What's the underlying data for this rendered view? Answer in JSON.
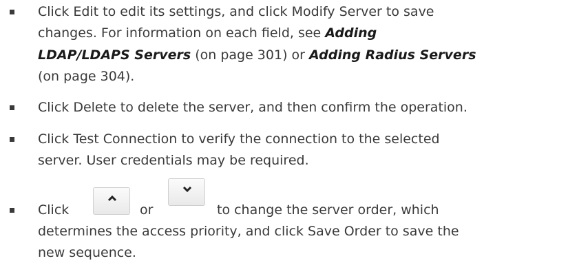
{
  "items": [
    {
      "lines": [
        {
          "parts": [
            {
              "t": "Click Edit to edit its settings, and click Modify Server to save"
            }
          ]
        },
        {
          "parts": [
            {
              "t": "changes. For information on each field, see "
            },
            {
              "t": "Adding",
              "ref": true
            }
          ]
        },
        {
          "parts": [
            {
              "t": "LDAP/LDAPS Servers",
              "ref": true
            },
            {
              "t": " (on page 301) or "
            },
            {
              "t": "Adding Radius Servers",
              "ref": true
            }
          ]
        },
        {
          "parts": [
            {
              "t": "(on page 304)."
            }
          ]
        }
      ]
    },
    {
      "lines": [
        {
          "parts": [
            {
              "t": "Click Delete to delete the server, and then confirm the operation."
            }
          ]
        }
      ]
    },
    {
      "lines": [
        {
          "parts": [
            {
              "t": "Click Test Connection to verify the connection to the selected"
            }
          ]
        },
        {
          "parts": [
            {
              "t": "server. User credentials may be required."
            }
          ]
        }
      ]
    }
  ],
  "order_item": {
    "click_word": "Click",
    "or_word": "or",
    "after_buttons": "to change the server order, which",
    "line2": "determines the access priority, and click Save Order to save the",
    "line3": "new sequence.",
    "up_button_icon": "chevron-up-icon",
    "down_button_icon": "chevron-down-icon"
  }
}
